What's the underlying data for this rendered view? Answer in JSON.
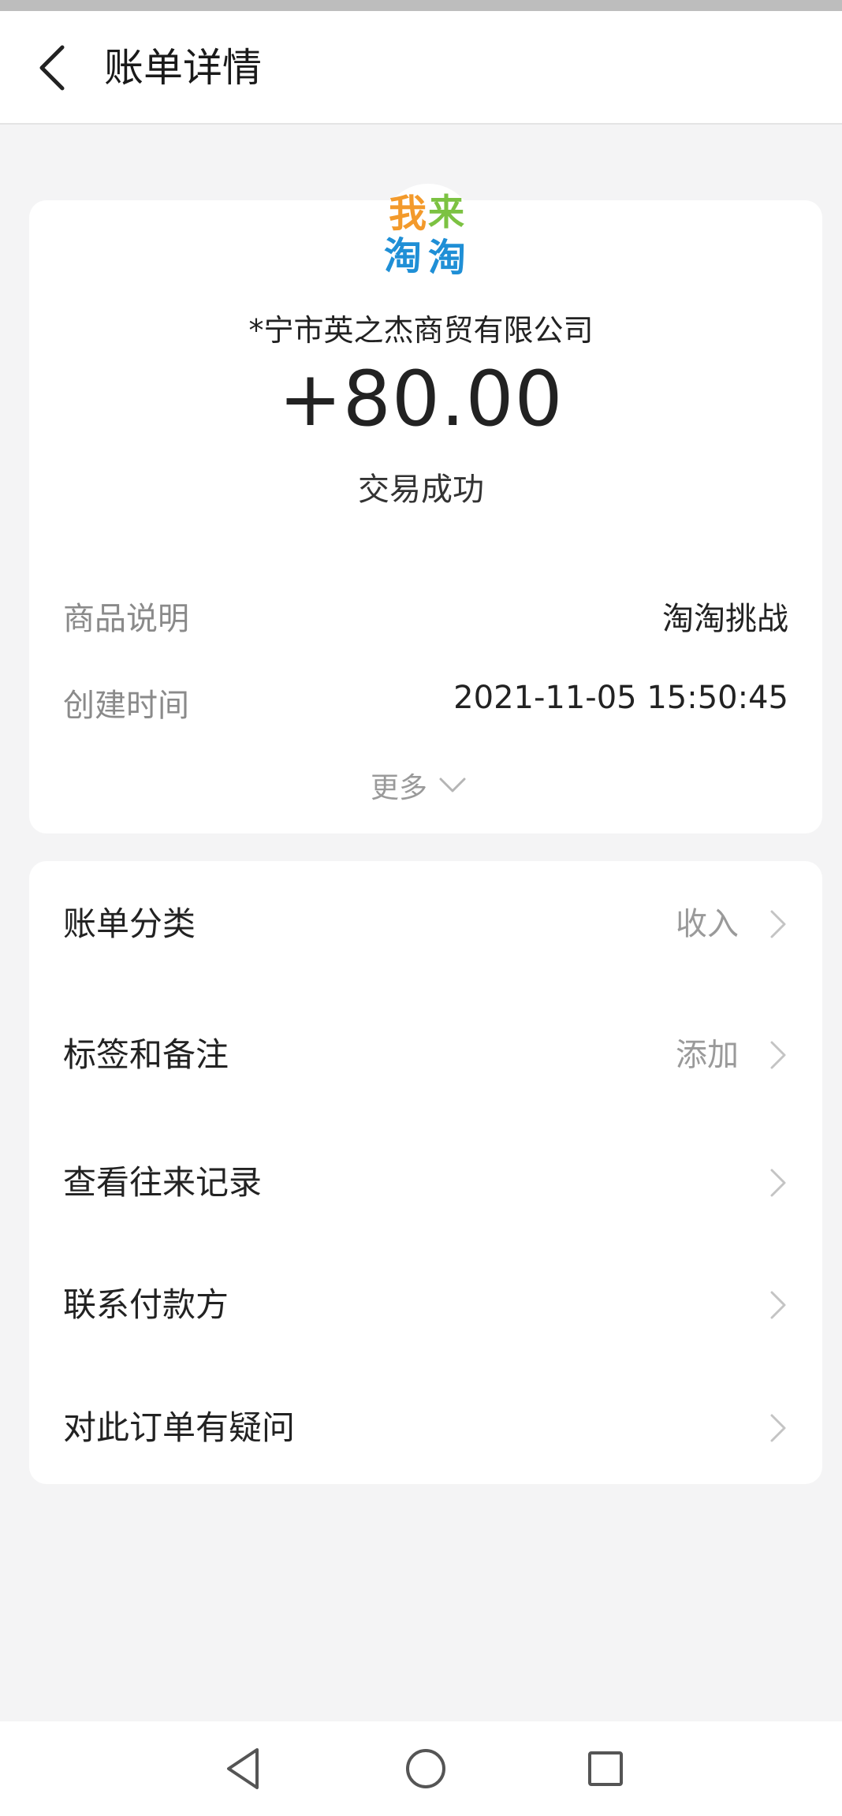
{
  "header": {
    "title": "账单详情",
    "back_icon": "chevron-left-icon"
  },
  "summary": {
    "logo_text_line1_a": "我",
    "logo_text_line1_b": "来",
    "logo_text_line2_a": "淘",
    "logo_text_line2_b": "淘",
    "merchant_name": "*宁市英之杰商贸有限公司",
    "amount": "+80.00",
    "status": "交易成功"
  },
  "details": [
    {
      "label": "商品说明",
      "value": "淘淘挑战"
    },
    {
      "label": "创建时间",
      "value": "2021-11-05 15:50:45"
    }
  ],
  "more_label": "更多",
  "menu": [
    {
      "label": "账单分类",
      "value": "收入"
    },
    {
      "label": "标签和备注",
      "value": "添加"
    },
    {
      "label": "查看往来记录",
      "value": ""
    },
    {
      "label": "联系付款方",
      "value": ""
    },
    {
      "label": "对此订单有疑问",
      "value": ""
    }
  ],
  "colors": {
    "background": "#f4f4f5",
    "card": "#ffffff",
    "text_primary": "#222222",
    "text_secondary": "#8a8a8a",
    "logo_orange": "#f39a2b",
    "logo_green": "#7cc242",
    "logo_blue": "#1f8fd6"
  },
  "navigation": [
    "back-triangle-icon",
    "home-circle-icon",
    "recents-square-icon"
  ]
}
